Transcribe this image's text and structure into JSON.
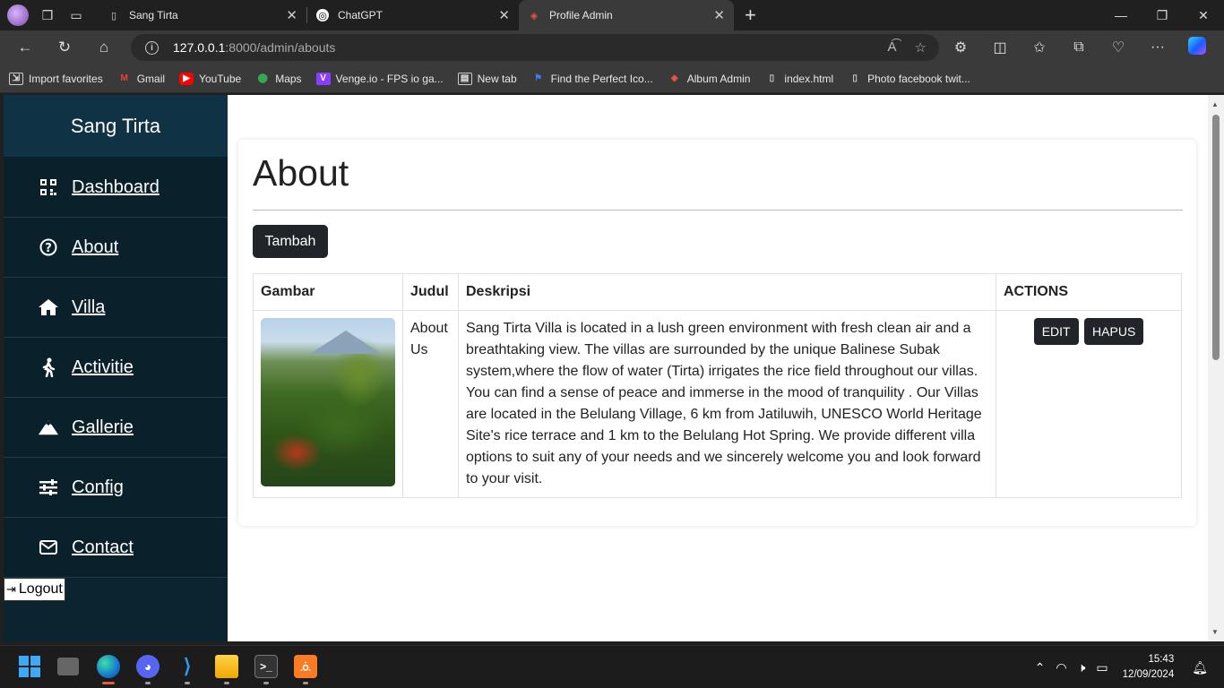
{
  "browser": {
    "tabs": [
      {
        "title": "Sang Tirta",
        "active": false
      },
      {
        "title": "ChatGPT",
        "active": false
      },
      {
        "title": "Profile Admin",
        "active": true
      }
    ],
    "url_host": "127.0.0.1",
    "url_rest": ":8000/admin/abouts",
    "favorites": [
      {
        "label": "Import favorites",
        "icon": "import-icon"
      },
      {
        "label": "Gmail",
        "icon": "gmail-icon"
      },
      {
        "label": "YouTube",
        "icon": "youtube-icon"
      },
      {
        "label": "Maps",
        "icon": "maps-icon"
      },
      {
        "label": "Venge.io - FPS io ga...",
        "icon": "venge-icon"
      },
      {
        "label": "New tab",
        "icon": "newtab-icon"
      },
      {
        "label": "Find the Perfect Ico...",
        "icon": "flag-icon"
      },
      {
        "label": "Album Admin",
        "icon": "laravel-icon"
      },
      {
        "label": "index.html",
        "icon": "file-icon"
      },
      {
        "label": "Photo facebook twit...",
        "icon": "file-icon"
      }
    ]
  },
  "sidebar": {
    "brand": "Sang Tirta",
    "items": [
      {
        "label": "Dashboard",
        "icon": "qr-grid-icon"
      },
      {
        "label": "About",
        "icon": "question-circle-icon"
      },
      {
        "label": "Villa",
        "icon": "home-icon"
      },
      {
        "label": "Activitie",
        "icon": "walking-person-icon"
      },
      {
        "label": "Gallerie",
        "icon": "mountain-icon"
      },
      {
        "label": "Config",
        "icon": "sliders-icon"
      },
      {
        "label": "Contact",
        "icon": "envelope-icon"
      }
    ],
    "logout_label": "Logout"
  },
  "main": {
    "title": "About",
    "add_button": "Tambah",
    "table": {
      "headers": [
        "Gambar",
        "Judul",
        "Deskripsi",
        "ACTIONS"
      ],
      "rows": [
        {
          "judul": "About Us",
          "deskripsi": "Sang Tirta Villa is located in a lush green environment with fresh clean air and a breathtaking view. The villas are surrounded by the unique Balinese Subak system,where the flow of water (Tirta) irrigates the rice field throughout our villas. You can find a sense of peace and immerse in the mood of tranquility . Our Villas are located in the Belulang Village, 6 km from Jatiluwih, UNESCO World Heritage Site's rice terrace and 1 km to the Belulang Hot Spring. We provide different villa options to suit any of your needs and we sincerely welcome you and look forward to your visit.",
          "edit_label": "EDIT",
          "delete_label": "HAPUS"
        }
      ]
    }
  },
  "taskbar": {
    "time": "15:43",
    "date": "12/09/2024"
  },
  "colors": {
    "sidebar_bg": "#0a212c",
    "brand_bg": "#0f3245",
    "button_dark": "#212529"
  }
}
